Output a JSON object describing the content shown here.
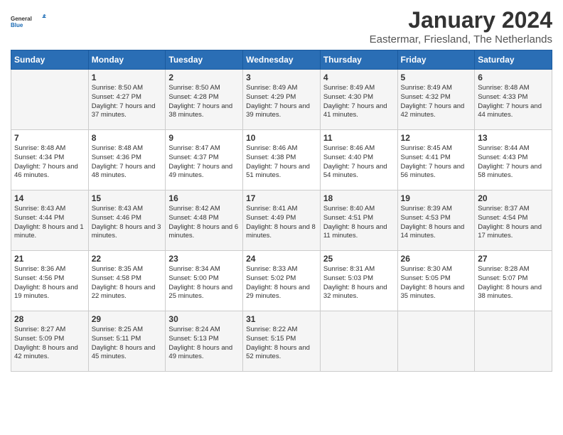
{
  "logo": {
    "line1": "General",
    "line2": "Blue"
  },
  "title": "January 2024",
  "location": "Eastermar, Friesland, The Netherlands",
  "days_of_week": [
    "Sunday",
    "Monday",
    "Tuesday",
    "Wednesday",
    "Thursday",
    "Friday",
    "Saturday"
  ],
  "weeks": [
    [
      {
        "day": "",
        "sunrise": "",
        "sunset": "",
        "daylight": ""
      },
      {
        "day": "1",
        "sunrise": "Sunrise: 8:50 AM",
        "sunset": "Sunset: 4:27 PM",
        "daylight": "Daylight: 7 hours and 37 minutes."
      },
      {
        "day": "2",
        "sunrise": "Sunrise: 8:50 AM",
        "sunset": "Sunset: 4:28 PM",
        "daylight": "Daylight: 7 hours and 38 minutes."
      },
      {
        "day": "3",
        "sunrise": "Sunrise: 8:49 AM",
        "sunset": "Sunset: 4:29 PM",
        "daylight": "Daylight: 7 hours and 39 minutes."
      },
      {
        "day": "4",
        "sunrise": "Sunrise: 8:49 AM",
        "sunset": "Sunset: 4:30 PM",
        "daylight": "Daylight: 7 hours and 41 minutes."
      },
      {
        "day": "5",
        "sunrise": "Sunrise: 8:49 AM",
        "sunset": "Sunset: 4:32 PM",
        "daylight": "Daylight: 7 hours and 42 minutes."
      },
      {
        "day": "6",
        "sunrise": "Sunrise: 8:48 AM",
        "sunset": "Sunset: 4:33 PM",
        "daylight": "Daylight: 7 hours and 44 minutes."
      }
    ],
    [
      {
        "day": "7",
        "sunrise": "Sunrise: 8:48 AM",
        "sunset": "Sunset: 4:34 PM",
        "daylight": "Daylight: 7 hours and 46 minutes."
      },
      {
        "day": "8",
        "sunrise": "Sunrise: 8:48 AM",
        "sunset": "Sunset: 4:36 PM",
        "daylight": "Daylight: 7 hours and 48 minutes."
      },
      {
        "day": "9",
        "sunrise": "Sunrise: 8:47 AM",
        "sunset": "Sunset: 4:37 PM",
        "daylight": "Daylight: 7 hours and 49 minutes."
      },
      {
        "day": "10",
        "sunrise": "Sunrise: 8:46 AM",
        "sunset": "Sunset: 4:38 PM",
        "daylight": "Daylight: 7 hours and 51 minutes."
      },
      {
        "day": "11",
        "sunrise": "Sunrise: 8:46 AM",
        "sunset": "Sunset: 4:40 PM",
        "daylight": "Daylight: 7 hours and 54 minutes."
      },
      {
        "day": "12",
        "sunrise": "Sunrise: 8:45 AM",
        "sunset": "Sunset: 4:41 PM",
        "daylight": "Daylight: 7 hours and 56 minutes."
      },
      {
        "day": "13",
        "sunrise": "Sunrise: 8:44 AM",
        "sunset": "Sunset: 4:43 PM",
        "daylight": "Daylight: 7 hours and 58 minutes."
      }
    ],
    [
      {
        "day": "14",
        "sunrise": "Sunrise: 8:43 AM",
        "sunset": "Sunset: 4:44 PM",
        "daylight": "Daylight: 8 hours and 1 minute."
      },
      {
        "day": "15",
        "sunrise": "Sunrise: 8:43 AM",
        "sunset": "Sunset: 4:46 PM",
        "daylight": "Daylight: 8 hours and 3 minutes."
      },
      {
        "day": "16",
        "sunrise": "Sunrise: 8:42 AM",
        "sunset": "Sunset: 4:48 PM",
        "daylight": "Daylight: 8 hours and 6 minutes."
      },
      {
        "day": "17",
        "sunrise": "Sunrise: 8:41 AM",
        "sunset": "Sunset: 4:49 PM",
        "daylight": "Daylight: 8 hours and 8 minutes."
      },
      {
        "day": "18",
        "sunrise": "Sunrise: 8:40 AM",
        "sunset": "Sunset: 4:51 PM",
        "daylight": "Daylight: 8 hours and 11 minutes."
      },
      {
        "day": "19",
        "sunrise": "Sunrise: 8:39 AM",
        "sunset": "Sunset: 4:53 PM",
        "daylight": "Daylight: 8 hours and 14 minutes."
      },
      {
        "day": "20",
        "sunrise": "Sunrise: 8:37 AM",
        "sunset": "Sunset: 4:54 PM",
        "daylight": "Daylight: 8 hours and 17 minutes."
      }
    ],
    [
      {
        "day": "21",
        "sunrise": "Sunrise: 8:36 AM",
        "sunset": "Sunset: 4:56 PM",
        "daylight": "Daylight: 8 hours and 19 minutes."
      },
      {
        "day": "22",
        "sunrise": "Sunrise: 8:35 AM",
        "sunset": "Sunset: 4:58 PM",
        "daylight": "Daylight: 8 hours and 22 minutes."
      },
      {
        "day": "23",
        "sunrise": "Sunrise: 8:34 AM",
        "sunset": "Sunset: 5:00 PM",
        "daylight": "Daylight: 8 hours and 25 minutes."
      },
      {
        "day": "24",
        "sunrise": "Sunrise: 8:33 AM",
        "sunset": "Sunset: 5:02 PM",
        "daylight": "Daylight: 8 hours and 29 minutes."
      },
      {
        "day": "25",
        "sunrise": "Sunrise: 8:31 AM",
        "sunset": "Sunset: 5:03 PM",
        "daylight": "Daylight: 8 hours and 32 minutes."
      },
      {
        "day": "26",
        "sunrise": "Sunrise: 8:30 AM",
        "sunset": "Sunset: 5:05 PM",
        "daylight": "Daylight: 8 hours and 35 minutes."
      },
      {
        "day": "27",
        "sunrise": "Sunrise: 8:28 AM",
        "sunset": "Sunset: 5:07 PM",
        "daylight": "Daylight: 8 hours and 38 minutes."
      }
    ],
    [
      {
        "day": "28",
        "sunrise": "Sunrise: 8:27 AM",
        "sunset": "Sunset: 5:09 PM",
        "daylight": "Daylight: 8 hours and 42 minutes."
      },
      {
        "day": "29",
        "sunrise": "Sunrise: 8:25 AM",
        "sunset": "Sunset: 5:11 PM",
        "daylight": "Daylight: 8 hours and 45 minutes."
      },
      {
        "day": "30",
        "sunrise": "Sunrise: 8:24 AM",
        "sunset": "Sunset: 5:13 PM",
        "daylight": "Daylight: 8 hours and 49 minutes."
      },
      {
        "day": "31",
        "sunrise": "Sunrise: 8:22 AM",
        "sunset": "Sunset: 5:15 PM",
        "daylight": "Daylight: 8 hours and 52 minutes."
      },
      {
        "day": "",
        "sunrise": "",
        "sunset": "",
        "daylight": ""
      },
      {
        "day": "",
        "sunrise": "",
        "sunset": "",
        "daylight": ""
      },
      {
        "day": "",
        "sunrise": "",
        "sunset": "",
        "daylight": ""
      }
    ]
  ]
}
